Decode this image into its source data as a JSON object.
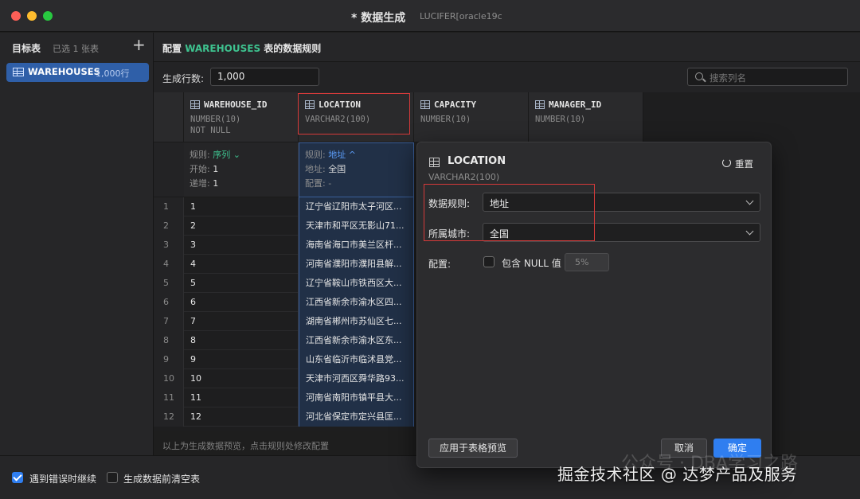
{
  "window": {
    "title": "* 数据生成",
    "connection": "LUCIFER[oracle19c"
  },
  "sidebar": {
    "header": "目标表",
    "selected_count": "已选 1 张表",
    "add_icon": "plus-icon",
    "items": [
      {
        "name": "WAREHOUSES",
        "rows": "1,000行"
      }
    ]
  },
  "main": {
    "header_prefix": "配置 ",
    "header_table": "WAREHOUSES",
    "header_suffix": " 表的数据规则",
    "rows_label": "生成行数:",
    "rows_value": "1,000",
    "search_placeholder": "搜索列名"
  },
  "columns": [
    {
      "name": "WAREHOUSE_ID",
      "type": "NUMBER(10)",
      "constraint": "NOT NULL"
    },
    {
      "name": "LOCATION",
      "type": "VARCHAR2(100)"
    },
    {
      "name": "CAPACITY",
      "type": "NUMBER(10)"
    },
    {
      "name": "MANAGER_ID",
      "type": "NUMBER(10)"
    }
  ],
  "rules": {
    "id": {
      "rule_label": "规则:",
      "rule_value": "序列",
      "start_label": "开始:",
      "start_value": "1",
      "step_label": "递增:",
      "step_value": "1"
    },
    "loc": {
      "rule_label": "规则:",
      "rule_value": "地址",
      "region_label": "地址:",
      "region_value": "全国",
      "config_label": "配置:",
      "config_value": "-"
    }
  },
  "rows": [
    {
      "idx": "1",
      "id": "1",
      "loc": "辽宁省辽阳市太子河区..."
    },
    {
      "idx": "2",
      "id": "2",
      "loc": "天津市和平区无影山71..."
    },
    {
      "idx": "3",
      "id": "3",
      "loc": "海南省海口市美兰区杆..."
    },
    {
      "idx": "4",
      "id": "4",
      "loc": "河南省濮阳市濮阳县解..."
    },
    {
      "idx": "5",
      "id": "5",
      "loc": "辽宁省鞍山市铁西区大..."
    },
    {
      "idx": "6",
      "id": "6",
      "loc": "江西省新余市渝水区四..."
    },
    {
      "idx": "7",
      "id": "7",
      "loc": "湖南省郴州市苏仙区七..."
    },
    {
      "idx": "8",
      "id": "8",
      "loc": "江西省新余市渝水区东..."
    },
    {
      "idx": "9",
      "id": "9",
      "loc": "山东省临沂市临沭县党..."
    },
    {
      "idx": "10",
      "id": "10",
      "loc": "天津市河西区舜华路93..."
    },
    {
      "idx": "11",
      "id": "11",
      "loc": "河南省南阳市镇平县大..."
    },
    {
      "idx": "12",
      "id": "12",
      "loc": "河北省保定市定兴县匡..."
    }
  ],
  "grid_footer": "以上为生成数据预览，点击规则处修改配置",
  "dialog": {
    "title": "LOCATION",
    "type": "VARCHAR2(100)",
    "reset_label": "重置",
    "rule_label": "数据规则:",
    "rule_value": "地址",
    "city_label": "所属城市:",
    "city_value": "全国",
    "config_label": "配置:",
    "null_label": "包含 NULL 值",
    "null_pct": "5%",
    "apply_button": "应用于表格预览",
    "cancel_button": "取消",
    "ok_button": "确定"
  },
  "bottom": {
    "continue_on_error": "遇到错误时继续",
    "continue_checked": true,
    "clear_table": "生成数据前清空表",
    "clear_checked": false
  },
  "watermark": "掘金技术社区 @ 达梦产品及服务",
  "watermark_ghost": "公众号 · DBA学习之路",
  "colors": {
    "accent": "#2f7ef0",
    "green": "#3ec28f",
    "highlight_red": "#d63a3a"
  }
}
